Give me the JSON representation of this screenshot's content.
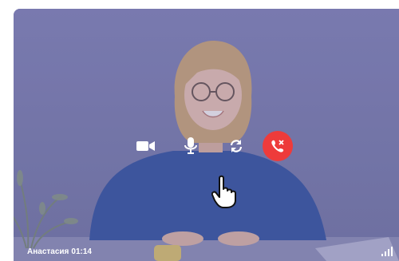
{
  "call": {
    "caller_name": "Анастасия",
    "duration": "01:14"
  },
  "controls": [
    {
      "name": "camera",
      "icon": "video-camera-icon"
    },
    {
      "name": "microphone",
      "icon": "microphone-icon"
    },
    {
      "name": "switch-camera",
      "icon": "switch-camera-icon"
    },
    {
      "name": "end-call",
      "icon": "phone-hangup-icon",
      "color": "#ee3b3b"
    }
  ],
  "signal": {
    "icon": "signal-strength-icon",
    "level": 1.0
  },
  "colors": {
    "overlay": "#7f7fb1",
    "hangup": "#ee3b3b",
    "text": "#ffffff"
  }
}
